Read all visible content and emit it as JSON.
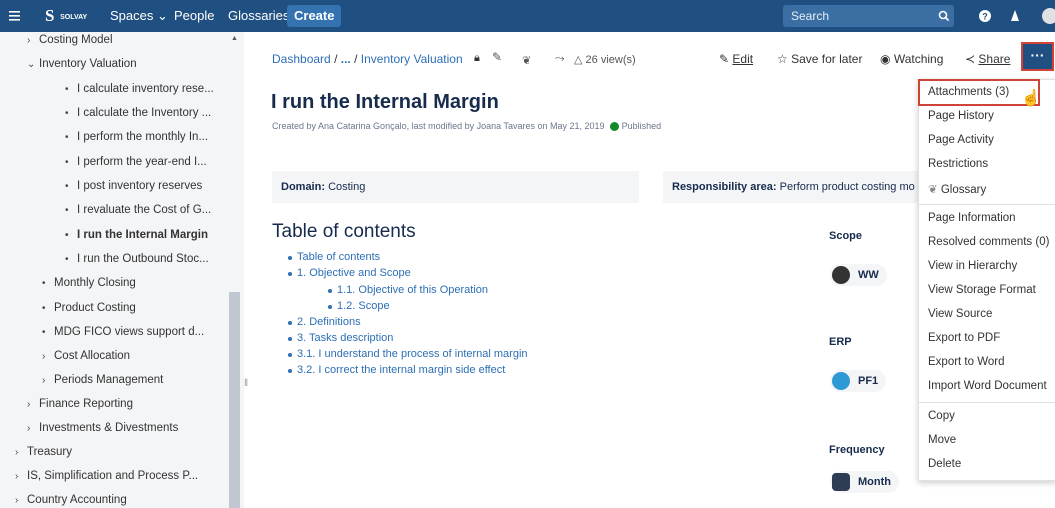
{
  "topbar": {
    "menu_icon": "hamburger-icon",
    "logo_text": "SOLVAY",
    "spaces": "Spaces ⌄",
    "people": "People",
    "glossaries": "Glossaries",
    "create": "Create",
    "search_placeholder": "Search"
  },
  "sidebar": {
    "items": [
      {
        "label": "Costing Model",
        "caret": "›"
      },
      {
        "label": "Inventory Valuation",
        "caret": "⌄"
      },
      {
        "label": "I calculate inventory rese...",
        "caret": "•"
      },
      {
        "label": "I calculate the Inventory ...",
        "caret": "•"
      },
      {
        "label": "I perform the monthly In...",
        "caret": "•"
      },
      {
        "label": "I perform the year-end I...",
        "caret": "•"
      },
      {
        "label": "I post inventory reserves",
        "caret": "•"
      },
      {
        "label": "I revaluate the Cost of G...",
        "caret": "•"
      },
      {
        "label": "I run the Internal Margin",
        "caret": "•"
      },
      {
        "label": "I run the Outbound Stoc...",
        "caret": "•"
      },
      {
        "label": "Monthly Closing",
        "caret": "•"
      },
      {
        "label": "Product Costing",
        "caret": "•"
      },
      {
        "label": "MDG FICO views support d...",
        "caret": "•"
      },
      {
        "label": "Cost Allocation",
        "caret": "›"
      },
      {
        "label": "Periods Management",
        "caret": "›"
      },
      {
        "label": "Finance Reporting",
        "caret": "›"
      },
      {
        "label": "Investments & Divestments",
        "caret": "›"
      },
      {
        "label": "Treasury",
        "caret": "›"
      },
      {
        "label": "IS, Simplification and Process P...",
        "caret": "›"
      },
      {
        "label": "Country Accounting",
        "caret": "›"
      }
    ]
  },
  "breadcrumb": {
    "dashboard": "Dashboard",
    "sep1": "/",
    "ellipsis": "...",
    "sep2": "/",
    "parent": "Inventory Valuation",
    "views": "26 view(s)"
  },
  "actions": {
    "edit": "Edit",
    "save_later": "Save for later",
    "watching": "Watching",
    "share": "Share",
    "more": "···"
  },
  "page": {
    "title": "I run the Internal Margin",
    "byline": "Created by Ana Catarina Gonçalo, last modified by Joana Tavares on May 21, 2019",
    "status": "Published",
    "domain_label": "Domain:",
    "domain_value": "Costing",
    "resp_label": "Responsibility area:",
    "resp_value": "Perform product costing mo"
  },
  "toc": {
    "heading": "Table of contents",
    "items": [
      "Table of contents",
      "1. Objective and Scope",
      "1.1. Objective of this Operation",
      "1.2. Scope",
      "2. Definitions",
      "3. Tasks description",
      "3.1. I understand the process of internal margin",
      "3.2. I correct the internal margin side effect"
    ]
  },
  "properties": {
    "scope_label": "Scope",
    "scope_value": "WW",
    "erp_label": "ERP",
    "erp_value": "PF1",
    "freq_label": "Frequency",
    "freq_value": "Month"
  },
  "menu": {
    "items": [
      "Attachments (3)",
      "Page History",
      "Page Activity",
      "Restrictions",
      "Glossary",
      "Page Information",
      "Resolved comments (0)",
      "View in Hierarchy",
      "View Storage Format",
      "View Source",
      "Export to PDF",
      "Export to Word",
      "Import Word Document",
      "Copy",
      "Move",
      "Delete"
    ]
  },
  "colors": {
    "header": "#205081",
    "link": "#2d6fb4",
    "highlight": "#d04437",
    "published": "#14892c"
  }
}
